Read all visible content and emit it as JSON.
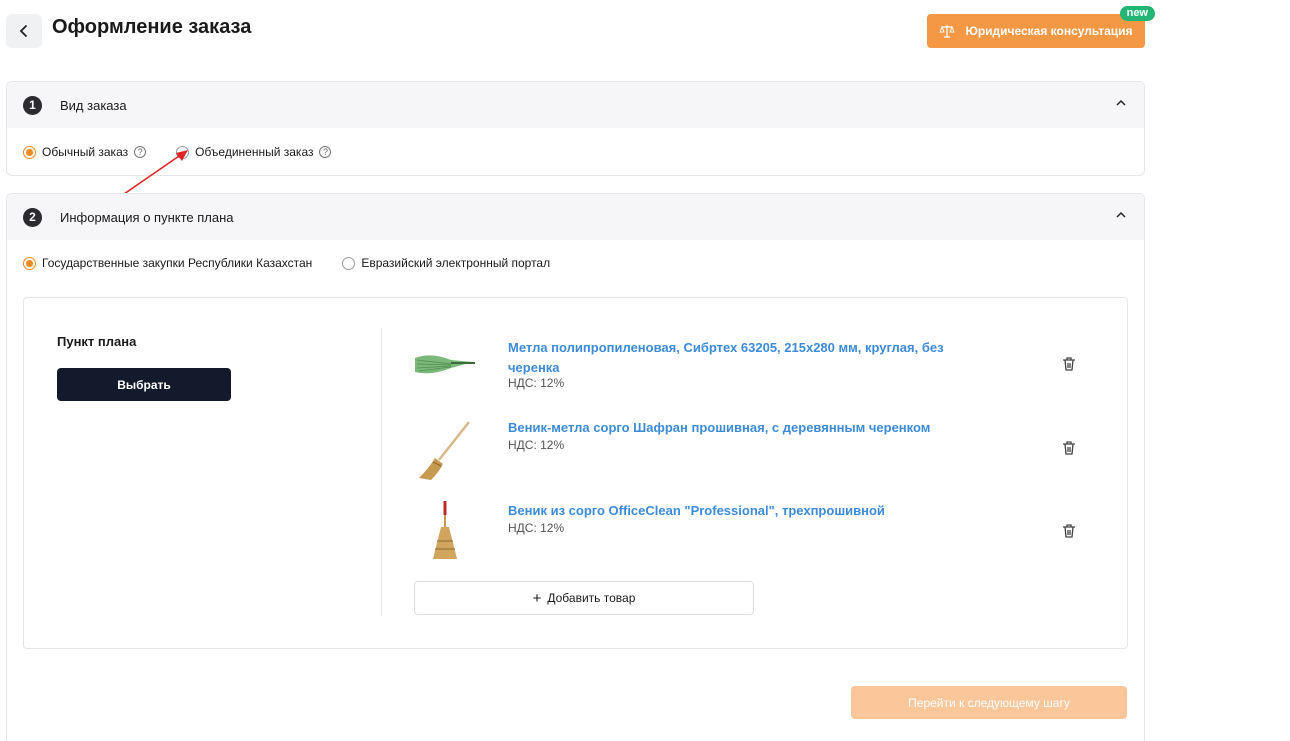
{
  "header": {
    "title": "Оформление заказа",
    "legal_button": "Юридическая консультация",
    "new_badge": "new"
  },
  "section1": {
    "number": "1",
    "title": "Вид заказа",
    "options": [
      {
        "label": "Обычный заказ",
        "selected": true
      },
      {
        "label": "Объединенный заказ",
        "selected": false
      }
    ]
  },
  "section2": {
    "number": "2",
    "title": "Информация о пункте плана",
    "options": [
      {
        "label": "Государственные закупки Республики Казахстан",
        "selected": true
      },
      {
        "label": "Евразийский электронный портал",
        "selected": false
      }
    ],
    "plan_label": "Пункт плана",
    "choose_button": "Выбрать",
    "products": [
      {
        "name": "Метла полипропиленовая, Сибртех 63205, 215х280 мм, круглая, без черенка",
        "vat": "НДС: 12%"
      },
      {
        "name": "Веник-метла сорго Шафран прошивная, с деревянным черенком",
        "vat": "НДС: 12%"
      },
      {
        "name": "Веник из сорго OfficeClean \"Professional\", трехпрошивной",
        "vat": "НДС: 12%"
      }
    ],
    "add_button": "Добавить товар"
  },
  "footer": {
    "next_button": "Перейти к следующему шагу"
  },
  "colors": {
    "accent": "#f08a24",
    "link": "#3c8bd9",
    "dark_button": "#121a2b",
    "badge": "#22b573"
  }
}
